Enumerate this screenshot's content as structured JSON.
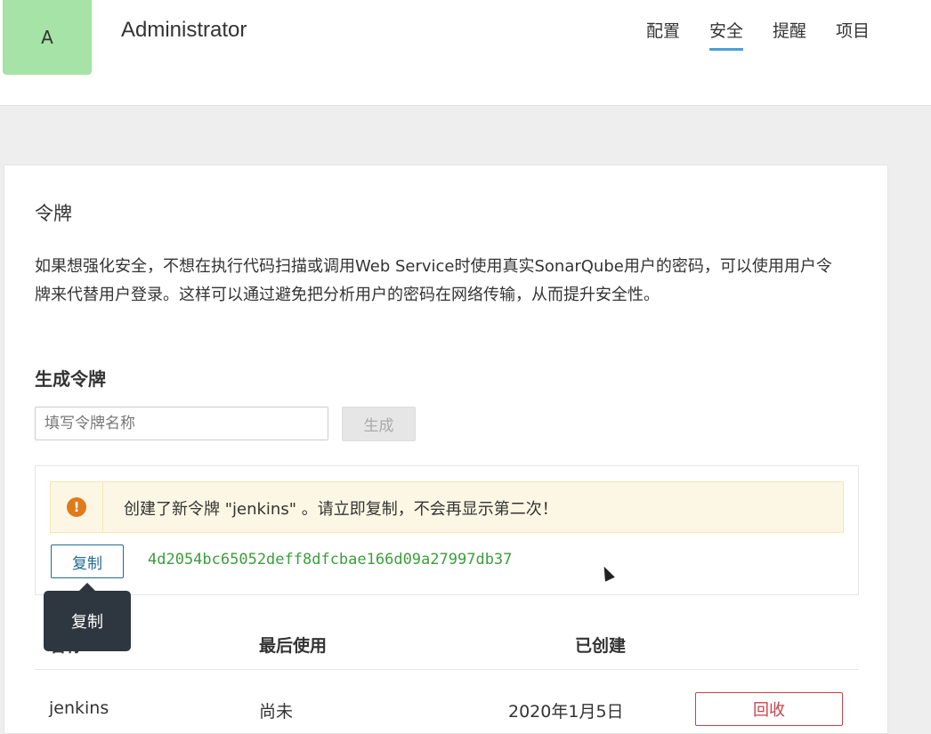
{
  "header": {
    "avatar_letter": "A",
    "username": "Administrator",
    "nav": [
      {
        "label": "配置"
      },
      {
        "label": "安全"
      },
      {
        "label": "提醒"
      },
      {
        "label": "项目"
      }
    ],
    "active_nav": "安全"
  },
  "tokens": {
    "title": "令牌",
    "description": "如果想强化安全，不想在执行代码扫描或调用Web Service时使用真实SonarQube用户的密码，可以使用用户令牌来代替用户登录。这样可以通过避免把分析用户的密码在网络传输，从而提升安全性。",
    "generate_title": "生成令牌",
    "input_placeholder": "填写令牌名称",
    "input_value": "",
    "generate_button": "生成",
    "alert_text": "创建了新令牌 \"jenkins\" 。请立即复制，不会再显示第二次！",
    "copy_button": "复制",
    "token_value": "4d2054bc65052deff8dfcbae166d09a27997db37",
    "tooltip": "复制",
    "table": {
      "columns": [
        "名称",
        "最后使用",
        "已创建"
      ],
      "rows": [
        {
          "name": "jenkins",
          "last_used": "尚未",
          "created": "2020年1月5日",
          "action": "回收"
        }
      ]
    }
  },
  "colors": {
    "accent": "#4b9fd5",
    "avatar_bg": "#a6e3a6",
    "token_text": "#3c9d3c",
    "revoke": "#c9424a",
    "warning_icon": "#e07a1a"
  }
}
